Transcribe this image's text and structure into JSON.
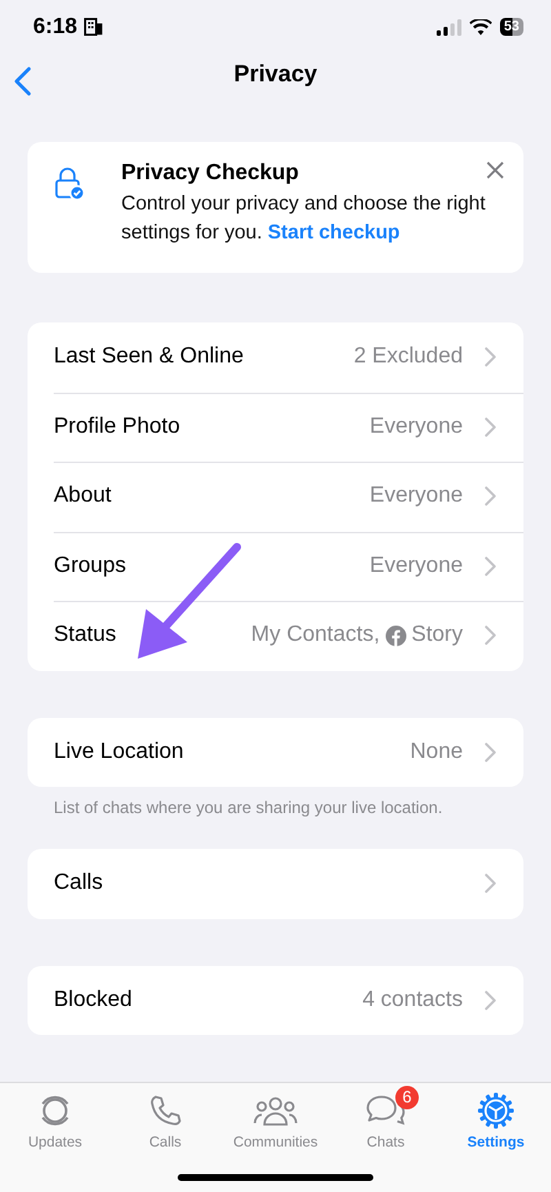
{
  "status_bar": {
    "time": "6:18",
    "battery": "53"
  },
  "nav": {
    "title": "Privacy"
  },
  "checkup": {
    "title": "Privacy Checkup",
    "text": "Control your privacy and choose the right settings for you.",
    "link": "Start checkup"
  },
  "sections": [
    {
      "rows": [
        {
          "label": "Last Seen & Online",
          "value": "2 Excluded"
        },
        {
          "label": "Profile Photo",
          "value": "Everyone"
        },
        {
          "label": "About",
          "value": "Everyone"
        },
        {
          "label": "Groups",
          "value": "Everyone"
        },
        {
          "label": "Status",
          "value": "My Contacts,",
          "value_after_icon": "Story"
        }
      ]
    },
    {
      "rows": [
        {
          "label": "Live Location",
          "value": "None"
        }
      ],
      "footer": "List of chats where you are sharing your live location."
    },
    {
      "rows": [
        {
          "label": "Calls"
        }
      ]
    },
    {
      "rows": [
        {
          "label": "Blocked",
          "value": "4 contacts"
        }
      ]
    }
  ],
  "tabs": [
    {
      "kind": "updates",
      "label": "Updates",
      "selected": false
    },
    {
      "kind": "calls",
      "label": "Calls",
      "selected": false
    },
    {
      "kind": "communities",
      "label": "Communities",
      "selected": false
    },
    {
      "kind": "chats",
      "label": "Chats",
      "selected": false,
      "badge": "6"
    },
    {
      "kind": "settings",
      "label": "Settings",
      "selected": true
    }
  ]
}
